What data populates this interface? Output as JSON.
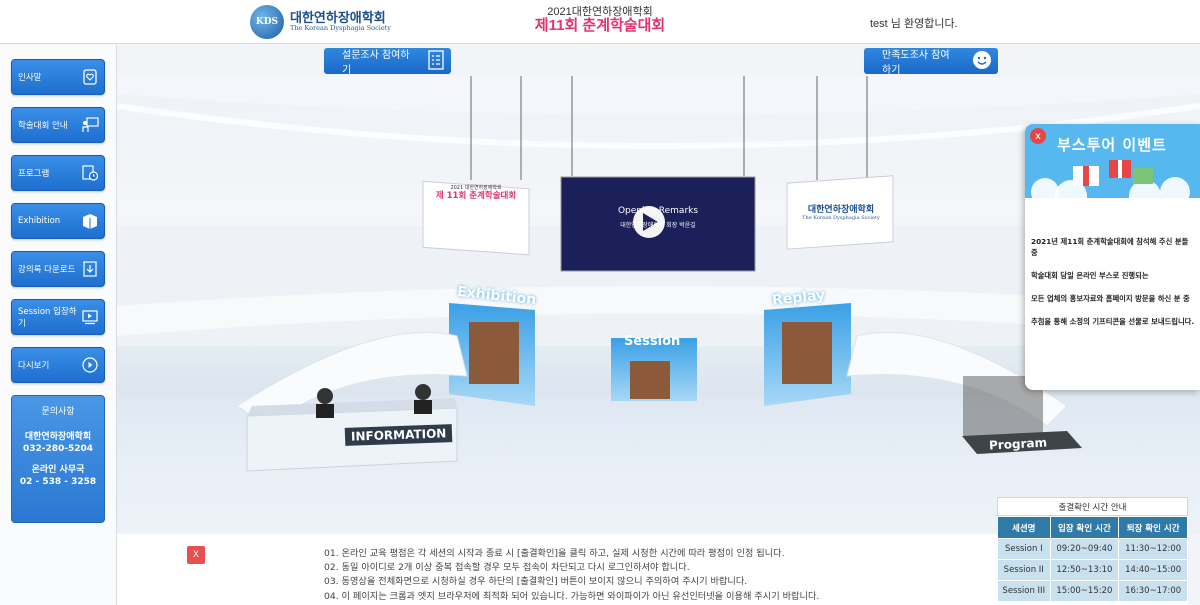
{
  "header": {
    "logo_mark": "KDS",
    "logo_ko": "대한연하장애학회",
    "logo_en": "The Korean Dysphagia Society",
    "event_sub": "2021대한연하장애학회",
    "event_title": "제11회 춘계학술대회",
    "welcome": "test 님 환영합니다."
  },
  "sidebar": {
    "items": [
      {
        "label": "인사말",
        "icon": "greeting-icon"
      },
      {
        "label": "학술대회 안내",
        "icon": "presentation-icon"
      },
      {
        "label": "프로그램",
        "icon": "schedule-icon"
      },
      {
        "label": "Exhibition",
        "icon": "booth-icon"
      },
      {
        "label": "강의록 다운로드",
        "icon": "download-icon"
      },
      {
        "label": "Session 입장하기",
        "icon": "video-icon"
      },
      {
        "label": "다시보기",
        "icon": "replay-icon"
      }
    ],
    "contact": {
      "title": "문의사항",
      "org": "대한연하장애학회",
      "org_phone": "032-280-5204",
      "office": "온라인 사무국",
      "office_phone": "02 - 538 - 3258"
    }
  },
  "survey": {
    "survey_label": "설문조사 참여하기",
    "satisfaction_label": "만족도조사 참여하기"
  },
  "scene": {
    "screen_left_sub": "2021 대한연하장애학회",
    "screen_left_title": "제 11회 춘계학술대회",
    "screen_center_text": "Opening Remarks",
    "screen_center_sub": "대한연하장애학회 회장 박윤길",
    "screen_right_ko": "대한연하장애학회",
    "screen_right_en": "The Korean Dysphagia Society",
    "sign_exhibition": "Exhibition",
    "sign_session": "Session",
    "sign_replay": "Replay",
    "desk_info": "INFORMATION",
    "sign_program": "Program"
  },
  "notice": {
    "close_label": "X",
    "lines": [
      "01. 온라인 교육 평점은 각 세션의 시작과 종료 시 [출결확인]을 클릭 하고, 실제 시청한 시간에 따라 평점이 인정 됩니다.",
      "02. 동일 아이디로 2개 이상 중복 접속할 경우 모두 접속이 차단되고 다시 로그인하셔야 합니다.",
      "03. 동영상을 전체화면으로 시청하실 경우 하단의 [출결확인] 버튼이 보이지 않으니 주의하여 주시기 바랍니다.",
      "04. 이 페이지는 크롬과 엣지 브라우저에 최적화 되어 있습니다. 가능하면 와이파이가 아닌 유선인터넷을 이용해 주시기 바랍니다."
    ]
  },
  "booth_popup": {
    "close": "x",
    "title": "부스투어 이벤트",
    "lines": [
      "2021년 제11회 춘계학술대회에 참석해 주신 분들 중",
      "학술대회 당일 온라인 부스로 진행되는",
      "모든 업체의 홍보자료와 홈페이지 방문을 하신 분 중",
      "추첨을 통해 소정의 기프티콘을 선물로 보내드립니다."
    ]
  },
  "attendance": {
    "title": "출결확인 시간 안내",
    "headers": [
      "세션명",
      "입장 확인 시간",
      "퇴장 확인 시간"
    ],
    "rows": [
      [
        "Session I",
        "09:20~09:40",
        "11:30~12:00"
      ],
      [
        "Session II",
        "12:50~13:10",
        "14:40~15:00"
      ],
      [
        "Session III",
        "15:00~15:20",
        "16:30~17:00"
      ]
    ]
  },
  "colors": {
    "accent": "#1e6fd0",
    "title_pink": "#e4336f",
    "table_header": "#2f7aa7",
    "table_cell": "#c9e0ee"
  }
}
